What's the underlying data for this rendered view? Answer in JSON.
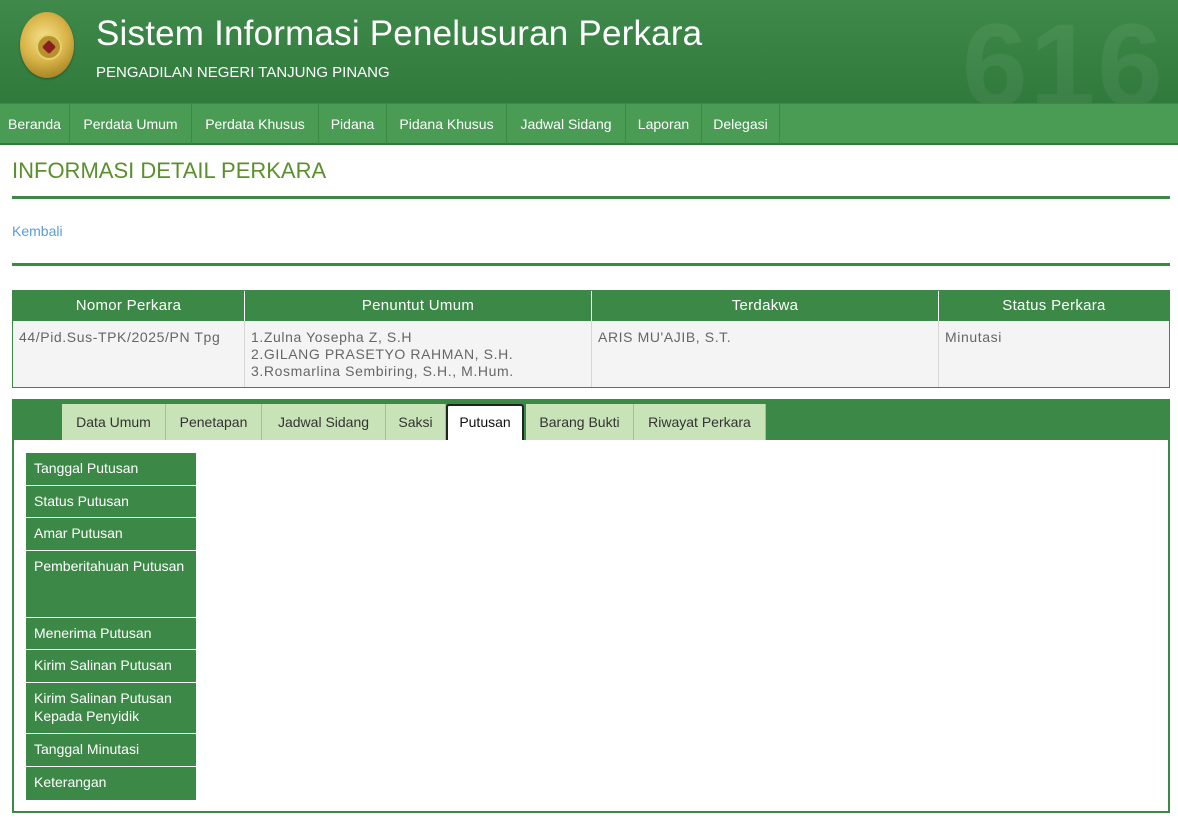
{
  "header": {
    "title": "Sistem Informasi Penelusuran Perkara",
    "subtitle": "PENGADILAN NEGERI TANJUNG PINANG",
    "watermark": "616",
    "logo_icon": "court-emblem-icon"
  },
  "nav": {
    "items": [
      "Beranda",
      "Perdata Umum",
      "Perdata Khusus",
      "Pidana",
      "Pidana Khusus",
      "Jadwal Sidang",
      "Laporan",
      "Delegasi"
    ]
  },
  "page": {
    "title": "INFORMASI DETAIL PERKARA",
    "back_label": "Kembali"
  },
  "summary": {
    "headers": [
      "Nomor Perkara",
      "Penuntut Umum",
      "Terdakwa",
      "Status Perkara"
    ],
    "row": {
      "nomor": "44/Pid.Sus-TPK/2025/PN Tpg",
      "penuntut": [
        "1.Zulna Yosepha Z, S.H",
        "2.GILANG PRASETYO RAHMAN, S.H.",
        "3.Rosmarlina Sembiring, S.H., M.Hum."
      ],
      "terdakwa": "ARIS MU'AJIB, S.T.",
      "status": "Minutasi"
    }
  },
  "tabs": {
    "items": [
      "Data Umum",
      "Penetapan",
      "Jadwal Sidang",
      "Saksi",
      "Putusan",
      "Barang Bukti",
      "Riwayat Perkara"
    ],
    "active": "Putusan"
  },
  "side_menu": {
    "items": [
      "Tanggal Putusan",
      "Status Putusan",
      "Amar Putusan",
      "Pemberitahuan Putusan",
      "Menerima Putusan",
      "Kirim Salinan Putusan",
      "Kirim Salinan Putusan Kepada Penyidik",
      "Tanggal Minutasi",
      "Keterangan"
    ]
  },
  "colors": {
    "header_green": "#2f7a3c",
    "nav_green": "#4a9b54",
    "table_green": "#3c8846",
    "title_olive": "#5a8f2e",
    "tab_light": "#c9e3b8",
    "link_blue": "#5b9bd5"
  }
}
